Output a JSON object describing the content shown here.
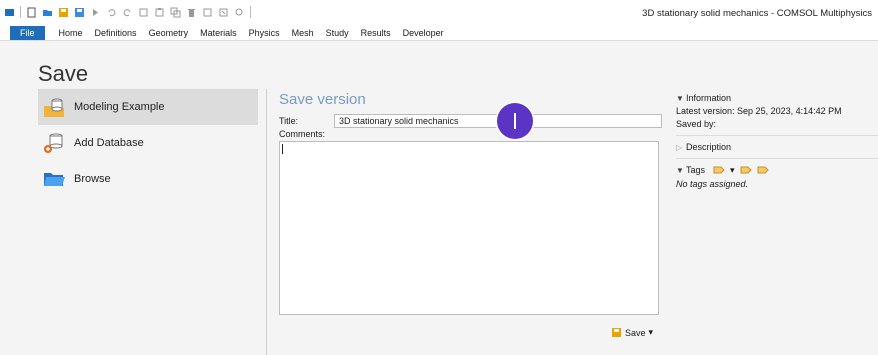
{
  "window": {
    "title": "3D stationary solid mechanics - COMSOL Multiphysics"
  },
  "menu": {
    "file": "File",
    "items": [
      "Home",
      "Definitions",
      "Geometry",
      "Materials",
      "Physics",
      "Mesh",
      "Study",
      "Results",
      "Developer"
    ]
  },
  "page": {
    "heading": "Save"
  },
  "left_nav": {
    "items": [
      {
        "label": "Modeling Example",
        "icon": "folder-database-icon",
        "active": true
      },
      {
        "label": "Add Database",
        "icon": "add-database-icon",
        "active": false
      },
      {
        "label": "Browse",
        "icon": "folder-open-icon",
        "active": false
      }
    ]
  },
  "save_version": {
    "heading": "Save version",
    "title_label": "Title:",
    "title_value": "3D stationary solid mechanics",
    "comments_label": "Comments:",
    "comments_value": "",
    "save_label": "Save"
  },
  "information": {
    "heading": "Information",
    "latest_version_label": "Latest version:",
    "latest_version_value": "Sep 25, 2023, 4:14:42 PM",
    "saved_by_label": "Saved by:",
    "saved_by_value": ""
  },
  "description": {
    "heading": "Description"
  },
  "tags": {
    "heading": "Tags",
    "empty_text": "No tags assigned."
  },
  "colors": {
    "accent": "#1f6cb8",
    "cursor_marker": "#5b34c6",
    "section_heading": "#7a9ac4"
  }
}
